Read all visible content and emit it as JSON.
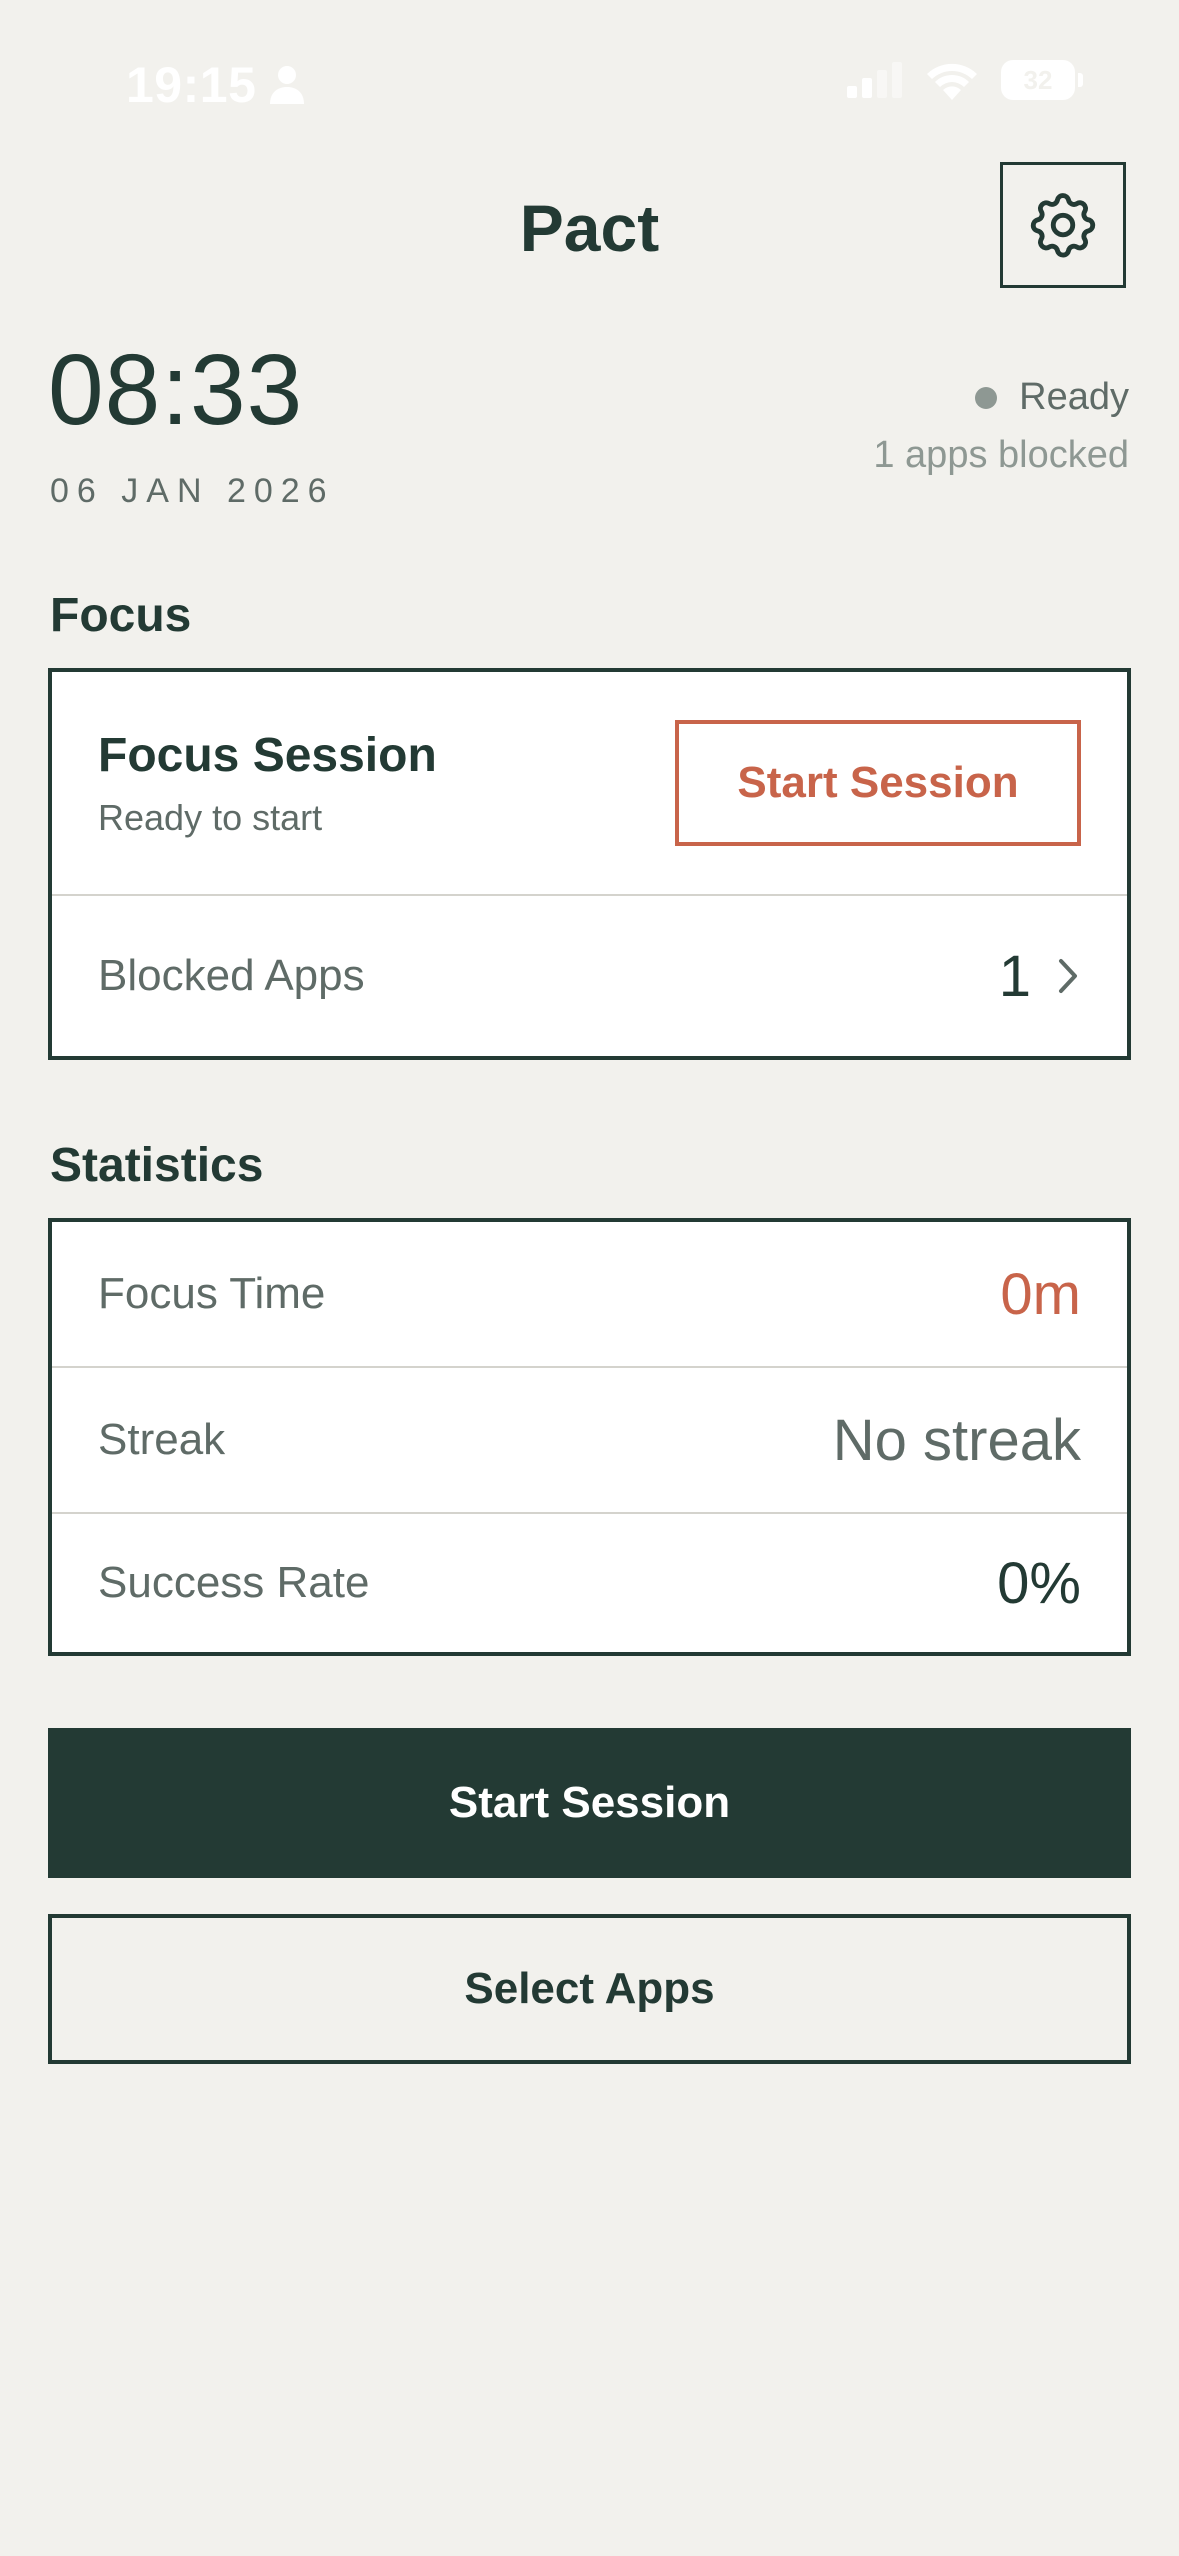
{
  "status_bar": {
    "time": "19:15",
    "battery": "32",
    "icons": [
      "person-icon",
      "cellular-signal-icon",
      "wifi-icon",
      "battery-icon"
    ]
  },
  "header": {
    "title": "Pact",
    "settings_icon": "gear-icon"
  },
  "clock": {
    "time": "08:33",
    "date": "06 JAN 2026",
    "status": "Ready",
    "apps_blocked": "1 apps blocked"
  },
  "focus": {
    "section_label": "Focus",
    "session_title": "Focus Session",
    "session_subtitle": "Ready to start",
    "start_button": "Start Session",
    "blocked_apps_label": "Blocked Apps",
    "blocked_apps_count": "1"
  },
  "statistics": {
    "section_label": "Statistics",
    "rows": [
      {
        "label": "Focus Time",
        "value": "0m"
      },
      {
        "label": "Streak",
        "value": "No streak"
      },
      {
        "label": "Success Rate",
        "value": "0%"
      }
    ]
  },
  "actions": {
    "primary": "Start Session",
    "secondary": "Select Apps"
  },
  "colors": {
    "background": "#f2f1ed",
    "primary": "#233a34",
    "accent": "#c8644a",
    "muted_text": "#5f6b67"
  }
}
